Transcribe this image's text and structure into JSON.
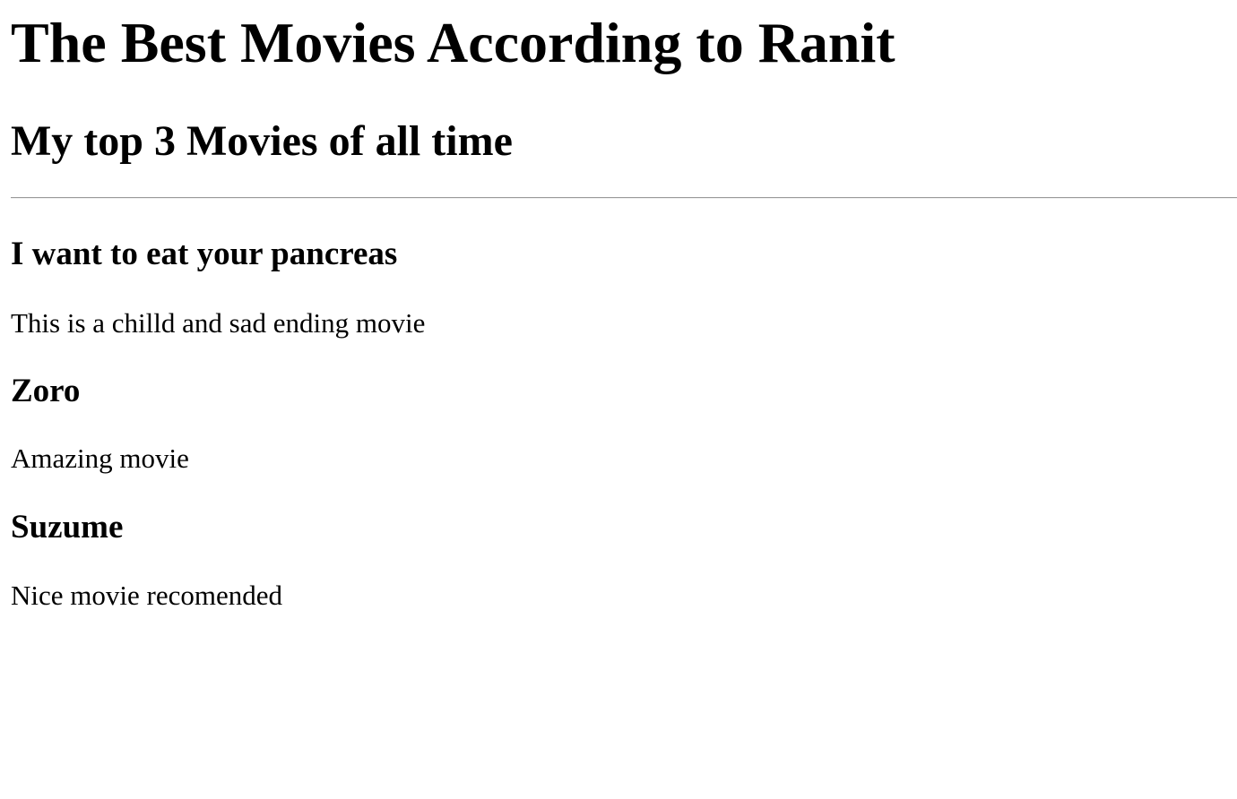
{
  "page": {
    "title": "The Best Movies According to Ranit",
    "subtitle": "My top 3 Movies of all time"
  },
  "movies": [
    {
      "title": "I want to eat your pancreas",
      "description": "This is a chilld and sad ending movie"
    },
    {
      "title": "Zoro",
      "description": "Amazing movie"
    },
    {
      "title": "Suzume",
      "description": "Nice movie recomended"
    }
  ]
}
